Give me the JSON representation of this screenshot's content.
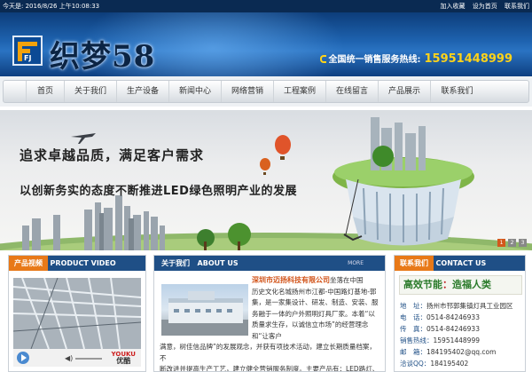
{
  "topbar": {
    "date": "今天是: 2016/8/26  上午10:08:33",
    "links": [
      "加入收藏",
      "设为首页",
      "联系我们"
    ]
  },
  "header": {
    "logo_mark": "FJ",
    "logo_text": "织梦58",
    "hotline_label": "全国统一销售服务热线:",
    "hotline_number": "15951448999"
  },
  "nav": {
    "items": [
      "首页",
      "关于我们",
      "生产设备",
      "新闻中心",
      "网络营销",
      "工程案例",
      "在线留言",
      "产品展示",
      "联系我们"
    ]
  },
  "banner": {
    "slogan1": "追求卓越品质，满足客户需求",
    "slogan2": "以创新务实的态度不断推进LED绿色照明产业的发展",
    "dots": [
      "1",
      "2",
      "3"
    ],
    "active_dot": 0
  },
  "video_panel": {
    "title": "产品视频",
    "subtitle": "PRODUCT VIDEO",
    "youku": "YOUKU",
    "youku_cn": "优酷"
  },
  "about_panel": {
    "title": "关于我们",
    "subtitle": "ABOUT US",
    "more": "MORE",
    "company": "深圳市迈扬科技有限公司",
    "lines": [
      "坐落在中国",
      "历史文化名城扬州市江都-中国路灯基地-郭",
      "集，是一家集设计、研发、制造、安装、服",
      "务融于一体的户外照明灯具厂家。本着“以",
      "质量求生存，以诚信立市场”的经营理念",
      "和“让客户"
    ],
    "tail_lines": [
      "满意，树佳信品牌”的发展观念，并获有项技术活动，建立长期质量档案，不",
      "断改进并提高生产工艺，建立健全营销服务制度。主要产品有：LED路灯、太"
    ]
  },
  "contact_panel": {
    "title": "联系我们",
    "subtitle": "CONTACT US",
    "ad_left": "高效节能",
    "ad_sep": "：",
    "ad_right": "造福人类",
    "items": [
      {
        "label": "地　址：",
        "value": "扬州市邗郭集镇灯具工业园区"
      },
      {
        "label": "电　话：",
        "value": "0514-84246933"
      },
      {
        "label": "传　真：",
        "value": "0514-84246933"
      },
      {
        "label": "销售热线：",
        "value": "15951448999"
      },
      {
        "label": "邮　箱：",
        "value": "184195402@qq.com"
      },
      {
        "label": "洽谈QQ：",
        "value": "184195402"
      }
    ]
  }
}
